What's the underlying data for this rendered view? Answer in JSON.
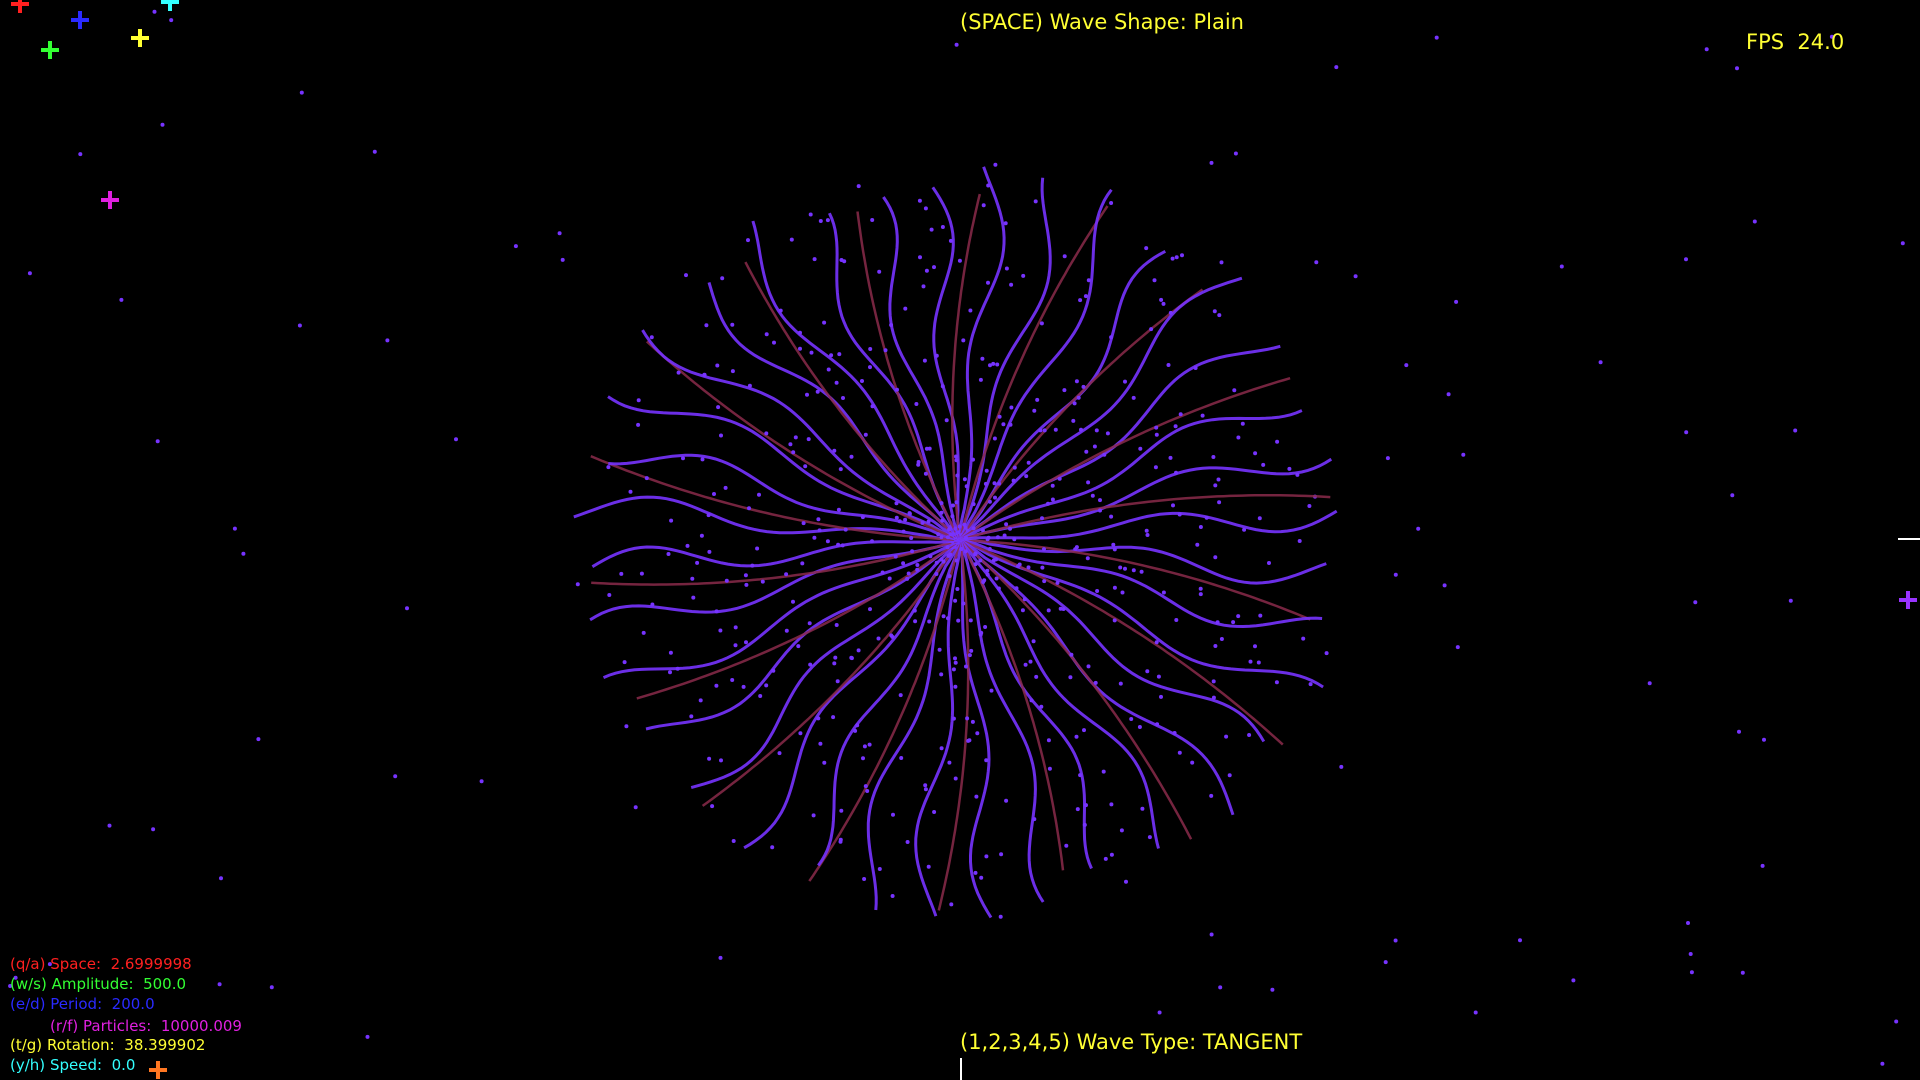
{
  "header": {
    "wave_shape_label": "(SPACE) Wave Shape: Plain",
    "fps_label": "FPS  24.0"
  },
  "footer": {
    "wave_type_label": "(1,2,3,4,5) Wave Type: TANGENT"
  },
  "controls": {
    "space": {
      "key": "(q/a)",
      "name": "Space:",
      "value": "2.6999998"
    },
    "amplitude": {
      "key": "(w/s)",
      "name": "Amplitude:",
      "value": "500.0"
    },
    "period": {
      "key": "(e/d)",
      "name": "Period:",
      "value": "200.0"
    },
    "particles": {
      "key": "(r/f)",
      "name": "Particles:",
      "value": "10000.009"
    },
    "rotation": {
      "key": "(t/g)",
      "name": "Rotation:",
      "value": "38.399902"
    },
    "speed": {
      "key": "(y/h)",
      "name": "Speed:",
      "value": "0.0"
    }
  },
  "colors": {
    "background": "#000000",
    "hud_yellow": "#ffff33",
    "space": "#ff2020",
    "amplitude": "#33ff33",
    "period": "#2a2aff",
    "particles": "#e020e0",
    "rotation": "#ffff33",
    "speed": "#33ffff",
    "particle_violet": "#7733ff",
    "arm_dark_red": "#8a2a4a"
  },
  "markers": [
    {
      "name": "red-cross-icon",
      "color": "#ff2020"
    },
    {
      "name": "blue-cross-icon",
      "color": "#2a2aff"
    },
    {
      "name": "cyan-cross-icon",
      "color": "#33ffff"
    },
    {
      "name": "yellow-cross-icon",
      "color": "#ffff33"
    },
    {
      "name": "green-cross-icon",
      "color": "#33ff33"
    },
    {
      "name": "magenta-cross-icon",
      "color": "#e020e0"
    },
    {
      "name": "purple-cross-icon",
      "color": "#9933ff"
    },
    {
      "name": "orange-cross-icon",
      "color": "#ff7722"
    }
  ]
}
